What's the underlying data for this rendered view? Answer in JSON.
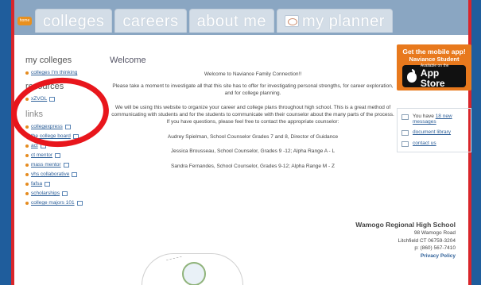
{
  "nav": {
    "home_label": "home",
    "tabs": [
      "colleges",
      "careers",
      "about me",
      "my planner"
    ]
  },
  "sidebar": {
    "my_colleges_heading": "my colleges",
    "my_colleges_links": [
      "colleges I'm thinking"
    ],
    "resources_heading": "resources",
    "resources_links": [
      "xZVOL"
    ],
    "links_heading": "links",
    "links": [
      "collegexpress",
      "the college board",
      "act",
      "ct mentor",
      "mass mentor",
      "vhs collaborative",
      "fafsa",
      "scholarships",
      "college majors 101"
    ]
  },
  "main": {
    "title": "Welcome",
    "welcome": "Welcome to Naviance Family Connection!!",
    "para1": "Please take a moment to investigate all that this site has to offer for investigating personal strengths, for career exploration, and for college planning.",
    "para2": "We will be using this website to organize your career and college plans throughout high school. This is a great method of communicating with students and for the students to communicate with their counselor about the many parts of the process. If you have questions, please feel free to contact the appropriate counselor:",
    "counselors": [
      "Audrey Spielman, School Counselor Grades 7 and 8, Director of Guidance",
      "Jessica Brousseau, School Counselor, Grades 9 -12;  Alpha Range A - L",
      "Sandra Fernandes, School Counselor, Grades 9-12;  Alpha Range  M - Z"
    ]
  },
  "right": {
    "promo_line1": "Get the mobile app!",
    "promo_line2": "Naviance Student",
    "appstore_small": "Available on the",
    "appstore_big": "App Store",
    "messages_prefix": "You have ",
    "messages_link": "18 new messages",
    "document_library": "document library",
    "contact_us": "contact us"
  },
  "footer": {
    "school": "Wamogo Regional High School",
    "address1": "98 Wamogo Road",
    "address2": "Litchfield CT 06759-3204",
    "phone": "p: (860) 567-7410",
    "privacy": "Privacy Policy"
  },
  "colors": {
    "background": "#1f5d9c",
    "frame_border": "#d8262b",
    "accent_orange": "#e8791d",
    "link_blue": "#2d5f98",
    "annotation_circle": "#e8161c"
  }
}
